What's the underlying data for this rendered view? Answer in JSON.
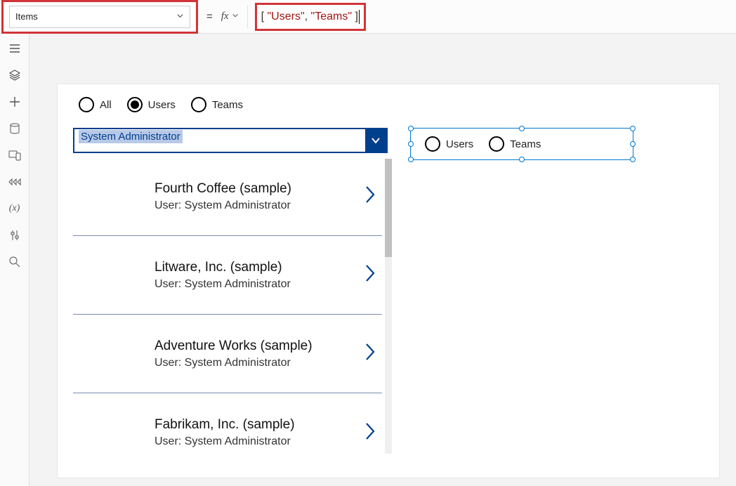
{
  "topbar": {
    "property": "Items",
    "fx_label": "fx",
    "formula_tokens": [
      "[ ",
      "\"Users\"",
      ", ",
      "\"Teams\"",
      " ]"
    ]
  },
  "sidebar_icons": [
    "hamburger",
    "layers",
    "plus",
    "database",
    "phone",
    "steps",
    "variable",
    "sliders",
    "search"
  ],
  "app": {
    "radios": [
      {
        "label": "All",
        "checked": false
      },
      {
        "label": "Users",
        "checked": true
      },
      {
        "label": "Teams",
        "checked": false
      }
    ],
    "combo_value": "System Administrator",
    "list": [
      {
        "title": "Fourth Coffee (sample)",
        "sub": "User: System Administrator"
      },
      {
        "title": "Litware, Inc. (sample)",
        "sub": "User: System Administrator"
      },
      {
        "title": "Adventure Works (sample)",
        "sub": "User: System Administrator"
      },
      {
        "title": "Fabrikam, Inc. (sample)",
        "sub": "User: System Administrator"
      }
    ]
  },
  "selected_control": {
    "options": [
      "Users",
      "Teams"
    ]
  }
}
